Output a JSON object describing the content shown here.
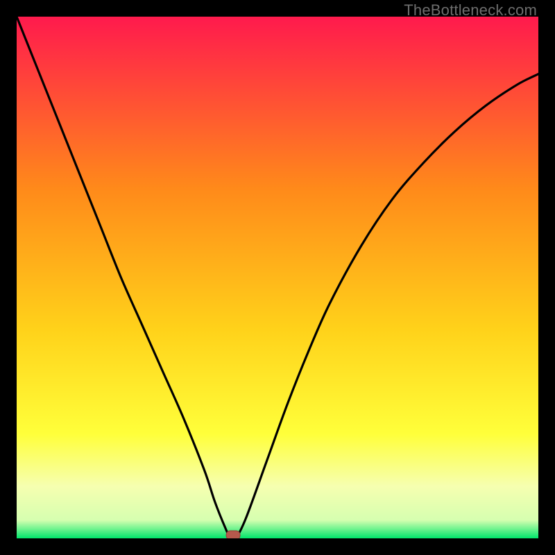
{
  "watermark": "TheBottleneck.com",
  "colors": {
    "black": "#000000",
    "curve": "#000000",
    "marker_fill": "#b5594c",
    "marker_stroke": "#8f3f36",
    "grad_top": "#ff1a4d",
    "grad_mid_upper": "#ff7a1a",
    "grad_mid": "#ffd21a",
    "grad_mid_lower": "#ffff3a",
    "grad_pale": "#f6ffb0",
    "grad_green": "#00e66b"
  },
  "chart_data": {
    "type": "line",
    "title": "",
    "xlabel": "",
    "ylabel": "",
    "xlim": [
      0,
      100
    ],
    "ylim": [
      0,
      100
    ],
    "series": [
      {
        "name": "bottleneck-curve",
        "x": [
          0,
          4,
          8,
          12,
          16,
          20,
          24,
          28,
          32,
          36,
          38,
          40,
          41,
          42,
          44,
          48,
          52,
          56,
          60,
          66,
          72,
          78,
          84,
          90,
          96,
          100
        ],
        "y": [
          100,
          90,
          80,
          70,
          60,
          50,
          41,
          32,
          23,
          13,
          7,
          2,
          0,
          0,
          4,
          15,
          26,
          36,
          45,
          56,
          65,
          72,
          78,
          83,
          87,
          89
        ]
      }
    ],
    "flat_segment": {
      "x_start": 40,
      "x_end": 42,
      "y": 0
    },
    "marker": {
      "x": 41.5,
      "y": 0.6
    },
    "gradient_stops": [
      {
        "offset": 0.0,
        "color": "#ff1a4d"
      },
      {
        "offset": 0.33,
        "color": "#ff8a1a"
      },
      {
        "offset": 0.6,
        "color": "#ffd21a"
      },
      {
        "offset": 0.8,
        "color": "#ffff3a"
      },
      {
        "offset": 0.9,
        "color": "#f6ffb0"
      },
      {
        "offset": 0.965,
        "color": "#d6ffb0"
      },
      {
        "offset": 1.0,
        "color": "#00e66b"
      }
    ]
  }
}
